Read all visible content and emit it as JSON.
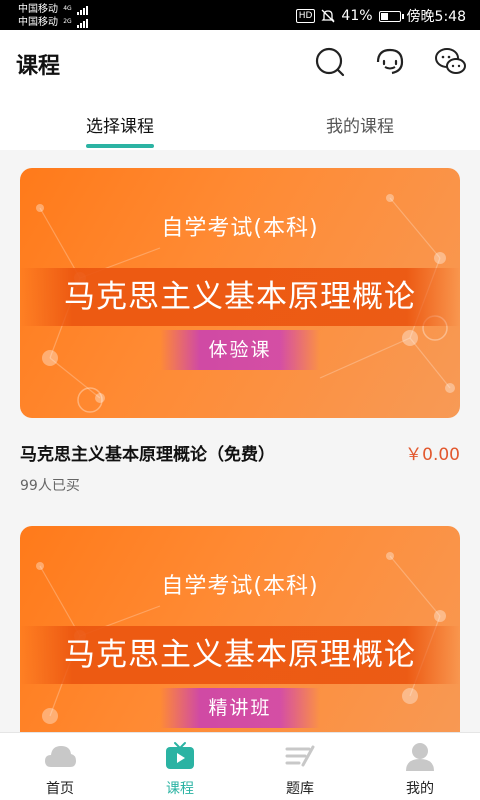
{
  "status_bar": {
    "carrier_1": "中国移动",
    "carrier_1_network": "4G",
    "carrier_2": "中国移动",
    "carrier_2_network": "2G",
    "battery_percent_text": "41%",
    "battery_level": 0.41,
    "time": "傍晚5:48",
    "hd_label": "HD"
  },
  "header": {
    "title": "课程",
    "icons": [
      "search-icon",
      "support-headset-icon",
      "chat-icon"
    ]
  },
  "tabs": [
    {
      "label": "选择课程",
      "active": true
    },
    {
      "label": "我的课程",
      "active": false
    }
  ],
  "courses": [
    {
      "banner_subtitle": "自学考试(本科)",
      "banner_title": "马克思主义基本原理概论",
      "banner_badge": "体验课",
      "title": "马克思主义基本原理概论（免费）",
      "price": "￥0.00",
      "sold": "99人已买"
    },
    {
      "banner_subtitle": "自学考试(本科)",
      "banner_title": "马克思主义基本原理概论",
      "banner_badge": "精讲班"
    }
  ],
  "bottom_nav": [
    {
      "label": "首页",
      "icon": "home-cloud-icon",
      "active": false
    },
    {
      "label": "课程",
      "icon": "course-play-icon",
      "active": true
    },
    {
      "label": "题库",
      "icon": "question-bank-icon",
      "active": false
    },
    {
      "label": "我的",
      "icon": "profile-icon",
      "active": false
    }
  ],
  "colors": {
    "accent": "#2bb3a3",
    "price": "#e2582e",
    "banner": "#ff8a33"
  }
}
